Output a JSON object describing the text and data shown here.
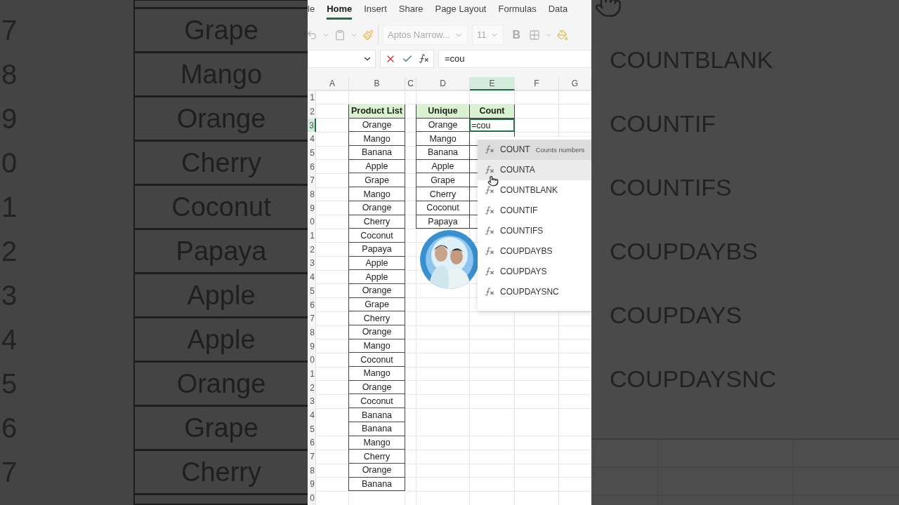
{
  "left_zoom": {
    "row_numbers": [
      "7",
      "8",
      "9",
      "0",
      "1",
      "2",
      "3",
      "4",
      "5",
      "6",
      "7"
    ],
    "cells": [
      "Grape",
      "Mango",
      "Orange",
      "Cherry",
      "Coconut",
      "Papaya",
      "Apple",
      "Apple",
      "Orange",
      "Grape",
      "Cherry"
    ]
  },
  "ribbon": {
    "tabs": [
      {
        "label": "le",
        "selected": false
      },
      {
        "label": "Home",
        "selected": true
      },
      {
        "label": "Insert",
        "selected": false
      },
      {
        "label": "Share",
        "selected": false
      },
      {
        "label": "Page Layout",
        "selected": false
      },
      {
        "label": "Formulas",
        "selected": false
      },
      {
        "label": "Data",
        "selected": false
      }
    ],
    "font": "Aptos Narrow...",
    "font_size": "11",
    "bold": "B"
  },
  "formula_bar": {
    "value": "=cou"
  },
  "sheet": {
    "columns": [
      {
        "label": "A",
        "selected": false
      },
      {
        "label": "B",
        "selected": false
      },
      {
        "label": "C",
        "selected": false
      },
      {
        "label": "D",
        "selected": false
      },
      {
        "label": "E",
        "selected": true
      },
      {
        "label": "F",
        "selected": false
      },
      {
        "label": "G",
        "selected": false
      }
    ],
    "rows": [
      {
        "label": "1",
        "selected": false
      },
      {
        "label": "2",
        "selected": false
      },
      {
        "label": "3",
        "selected": true
      },
      {
        "label": "4",
        "selected": false
      },
      {
        "label": "5",
        "selected": false
      },
      {
        "label": "6",
        "selected": false
      },
      {
        "label": "7",
        "selected": false
      },
      {
        "label": "8",
        "selected": false
      },
      {
        "label": "9",
        "selected": false
      },
      {
        "label": "0",
        "selected": false
      },
      {
        "label": "1",
        "selected": false
      },
      {
        "label": "2",
        "selected": false
      },
      {
        "label": "3",
        "selected": false
      },
      {
        "label": "4",
        "selected": false
      },
      {
        "label": "5",
        "selected": false
      },
      {
        "label": "6",
        "selected": false
      },
      {
        "label": "7",
        "selected": false
      },
      {
        "label": "8",
        "selected": false
      },
      {
        "label": "9",
        "selected": false
      },
      {
        "label": "0",
        "selected": false
      },
      {
        "label": "1",
        "selected": false
      },
      {
        "label": "2",
        "selected": false
      },
      {
        "label": "3",
        "selected": false
      },
      {
        "label": "4",
        "selected": false
      },
      {
        "label": "5",
        "selected": false
      },
      {
        "label": "6",
        "selected": false
      },
      {
        "label": "7",
        "selected": false
      },
      {
        "label": "8",
        "selected": false
      },
      {
        "label": "9",
        "selected": false
      },
      {
        "label": "0",
        "selected": false
      }
    ],
    "product_list": {
      "header": "Product List",
      "items": [
        "Orange",
        "Mango",
        "Banana",
        "Apple",
        "Grape",
        "Mango",
        "Orange",
        "Cherry",
        "Coconut",
        "Papaya",
        "Apple",
        "Apple",
        "Orange",
        "Grape",
        "Cherry",
        "Orange",
        "Mango",
        "Coconut",
        "Mango",
        "Orange",
        "Coconut",
        "Banana",
        "Banana",
        "Mango",
        "Cherry",
        "Orange",
        "Banana"
      ]
    },
    "unique_table": {
      "headers": [
        "Unique",
        "Count"
      ],
      "items": [
        "Orange",
        "Mango",
        "Banana",
        "Apple",
        "Grape",
        "Cherry",
        "Coconut",
        "Papaya"
      ],
      "editing_value": "=cou"
    }
  },
  "autocomplete": [
    {
      "name": "COUNT",
      "description": "Counts numbers",
      "selected": true,
      "hovered": false
    },
    {
      "name": "COUNTA",
      "selected": false,
      "hovered": true
    },
    {
      "name": "COUNTBLANK",
      "selected": false,
      "hovered": false
    },
    {
      "name": "COUNTIF",
      "selected": false,
      "hovered": false
    },
    {
      "name": "COUNTIFS",
      "selected": false,
      "hovered": false
    },
    {
      "name": "COUPDAYBS",
      "selected": false,
      "hovered": false
    },
    {
      "name": "COUPDAYS",
      "selected": false,
      "hovered": false
    },
    {
      "name": "COUPDAYSNC",
      "selected": false,
      "hovered": false
    }
  ],
  "right_zoom": {
    "functions": [
      "COUNTBLANK",
      "COUNTIF",
      "COUNTIFS",
      "COUPDAYBS",
      "COUPDAYS",
      "COUPDAYSNC"
    ]
  }
}
